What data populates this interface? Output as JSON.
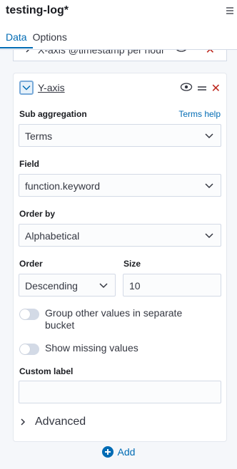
{
  "header": {
    "title": "testing-log*",
    "tabs": [
      {
        "label": "Data",
        "active": true
      },
      {
        "label": "Options",
        "active": false
      }
    ]
  },
  "xaxis": {
    "label": "X-axis @timestamp per hour"
  },
  "yaxis": {
    "label": "Y-axis",
    "sub_aggregation_label": "Sub aggregation",
    "terms_help": "Terms help",
    "sub_aggregation_value": "Terms",
    "field_label": "Field",
    "field_value": "function.keyword",
    "order_by_label": "Order by",
    "order_by_value": "Alphabetical",
    "order_label": "Order",
    "order_value": "Descending",
    "size_label": "Size",
    "size_value": "10",
    "group_other_label": "Group other values in separate bucket",
    "group_other_on": false,
    "show_missing_label": "Show missing values",
    "show_missing_on": false,
    "custom_label_label": "Custom label",
    "custom_label_value": "",
    "advanced_label": "Advanced"
  },
  "footer": {
    "add_label": "Add"
  },
  "colors": {
    "accent": "#006bb4",
    "danger": "#bd271e",
    "text": "#343741"
  }
}
